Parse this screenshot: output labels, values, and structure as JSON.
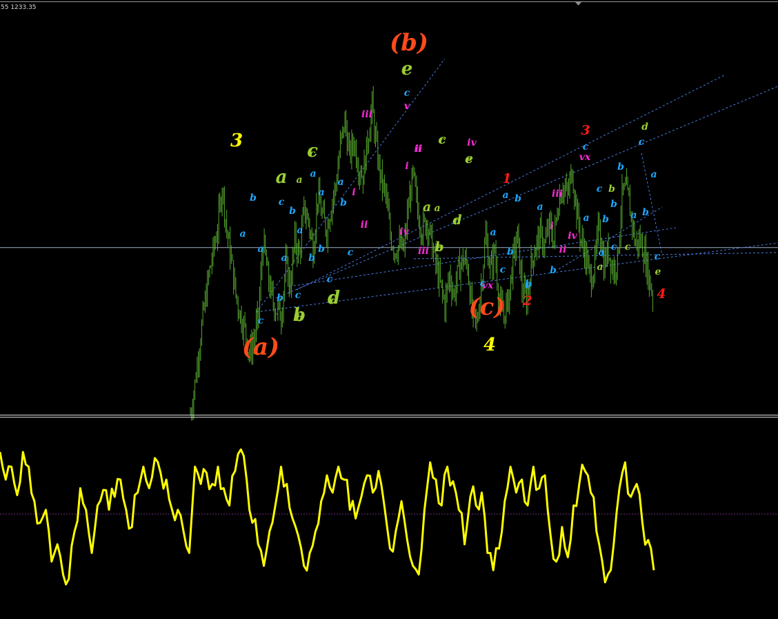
{
  "header": {
    "price_readout": "55 1233.35"
  },
  "colors": {
    "background": "#000000",
    "price_candles": "#55a82e",
    "oscillator": "#ffff00",
    "trendlines": "#4a7be0",
    "crosshair": "#9fb0c8",
    "zero_line": "#7a2a8a",
    "separator": "#ffffff"
  },
  "chart_data": [
    {
      "type": "bar",
      "description_key": "price",
      "title": "",
      "xlabel": "",
      "ylabel": "",
      "ylim": [
        0,
        100
      ],
      "grid": false,
      "crosshair_level": 67,
      "closes_pct_of_range": [
        0,
        12,
        28,
        42,
        55,
        65,
        75,
        92,
        74,
        62,
        48,
        40,
        34,
        24,
        30,
        40,
        70,
        56,
        46,
        42,
        40,
        60,
        52,
        70,
        64,
        82,
        78,
        66,
        88,
        80,
        74,
        84,
        92,
        108,
        118,
        104,
        110,
        100,
        96,
        110,
        124,
        106,
        94,
        88,
        72,
        66,
        68,
        66,
        84,
        96,
        82,
        74,
        78,
        70,
        60,
        52,
        44,
        56,
        48,
        58,
        62,
        60,
        40,
        36,
        52,
        72,
        58,
        66,
        44,
        40,
        46,
        62,
        72,
        50,
        46,
        60,
        68,
        72,
        68,
        76,
        70,
        86,
        92,
        88,
        98,
        82,
        70,
        64,
        54,
        60,
        78,
        60,
        66,
        58,
        62,
        88,
        90,
        80,
        68,
        70,
        64,
        54,
        46
      ],
      "wave_labels": [
        {
          "text": "3",
          "color": "#ffff00",
          "size": "large"
        },
        {
          "text": "(a)",
          "color": "#ff4a1a",
          "size": "xlarge"
        },
        {
          "text": "(b)",
          "color": "#ff4a1a",
          "size": "xlarge"
        },
        {
          "text": "(c)",
          "color": "#ff4a1a",
          "size": "xlarge"
        },
        {
          "text": "4",
          "color": "#ffff00",
          "size": "large"
        },
        {
          "text": "a",
          "color": "#9acd32",
          "size": "large"
        },
        {
          "text": "b",
          "color": "#9acd32",
          "size": "large"
        },
        {
          "text": "c",
          "color": "#9acd32",
          "size": "large"
        },
        {
          "text": "d",
          "color": "#9acd32",
          "size": "large"
        },
        {
          "text": "e",
          "color": "#9acd32",
          "size": "large"
        },
        {
          "text": "1",
          "color": "#ff1a1a",
          "size": "medium"
        },
        {
          "text": "2",
          "color": "#ff1a1a",
          "size": "medium"
        },
        {
          "text": "3",
          "color": "#ff1a1a",
          "size": "medium"
        },
        {
          "text": "4",
          "color": "#ff1a1a",
          "size": "medium"
        },
        {
          "text": "a",
          "color": "#9acd32",
          "size": "medium"
        },
        {
          "text": "b",
          "color": "#9acd32",
          "size": "medium"
        },
        {
          "text": "c",
          "color": "#9acd32",
          "size": "medium"
        },
        {
          "text": "d",
          "color": "#9acd32",
          "size": "medium"
        },
        {
          "text": "e",
          "color": "#9acd32",
          "size": "medium"
        },
        {
          "text": "a",
          "color": "#9acd32",
          "size": "small"
        },
        {
          "text": "b",
          "color": "#9acd32",
          "size": "small"
        },
        {
          "text": "c",
          "color": "#9acd32",
          "size": "small"
        },
        {
          "text": "d",
          "color": "#9acd32",
          "size": "small"
        },
        {
          "text": "e",
          "color": "#9acd32",
          "size": "small"
        },
        {
          "text": "a",
          "color": "#9acd32",
          "size": "small"
        },
        {
          "text": "b",
          "color": "#9acd32",
          "size": "small"
        },
        {
          "text": "c",
          "color": "#9acd32",
          "size": "small"
        },
        {
          "text": "d",
          "color": "#9acd32",
          "size": "small"
        },
        {
          "text": "a",
          "color": "#9acd32",
          "size": "small"
        },
        {
          "text": "b",
          "color": "#9acd32",
          "size": "small"
        },
        {
          "text": "c",
          "color": "#9acd32",
          "size": "small"
        },
        {
          "text": "d",
          "color": "#9acd32",
          "size": "small"
        },
        {
          "text": "e",
          "color": "#9acd32",
          "size": "small"
        },
        {
          "text": "iii",
          "color": "#ff2bd8",
          "size": "small"
        },
        {
          "text": "v",
          "color": "#ff2bd8",
          "size": "small"
        },
        {
          "text": "ii",
          "color": "#ff2bd8",
          "size": "small"
        },
        {
          "text": "i",
          "color": "#ff2bd8",
          "size": "small"
        },
        {
          "text": "iv",
          "color": "#ff2bd8",
          "size": "small"
        },
        {
          "text": "i",
          "color": "#ff2bd8",
          "size": "small"
        },
        {
          "text": "ii",
          "color": "#ff2bd8",
          "size": "small"
        },
        {
          "text": "iv",
          "color": "#ff2bd8",
          "size": "small"
        },
        {
          "text": "iii",
          "color": "#ff2bd8",
          "size": "small"
        },
        {
          "text": "vx",
          "color": "#ff2bd8",
          "size": "small"
        },
        {
          "text": "iii",
          "color": "#ff2bd8",
          "size": "small"
        },
        {
          "text": "i",
          "color": "#ff2bd8",
          "size": "small"
        },
        {
          "text": "iv",
          "color": "#ff2bd8",
          "size": "small"
        },
        {
          "text": "ii",
          "color": "#ff2bd8",
          "size": "small"
        },
        {
          "text": "vx",
          "color": "#ff2bd8",
          "size": "small"
        },
        {
          "text": "ii",
          "color": "#ff2bd8",
          "size": "small"
        },
        {
          "text": "a",
          "color": "#1ea8ff",
          "size": "small"
        },
        {
          "text": "b",
          "color": "#1ea8ff",
          "size": "small"
        },
        {
          "text": "a",
          "color": "#1ea8ff",
          "size": "small"
        },
        {
          "text": "c",
          "color": "#1ea8ff",
          "size": "small"
        },
        {
          "text": "b",
          "color": "#1ea8ff",
          "size": "small"
        },
        {
          "text": "c",
          "color": "#1ea8ff",
          "size": "small"
        },
        {
          "text": "b",
          "color": "#1ea8ff",
          "size": "small"
        },
        {
          "text": "a",
          "color": "#1ea8ff",
          "size": "small"
        },
        {
          "text": "a",
          "color": "#1ea8ff",
          "size": "small"
        },
        {
          "text": "b",
          "color": "#1ea8ff",
          "size": "small"
        },
        {
          "text": "c",
          "color": "#1ea8ff",
          "size": "small"
        },
        {
          "text": "a",
          "color": "#1ea8ff",
          "size": "small"
        },
        {
          "text": "b",
          "color": "#1ea8ff",
          "size": "small"
        },
        {
          "text": "a",
          "color": "#1ea8ff",
          "size": "small"
        },
        {
          "text": "b",
          "color": "#1ea8ff",
          "size": "small"
        },
        {
          "text": "c",
          "color": "#1ea8ff",
          "size": "small"
        },
        {
          "text": "c",
          "color": "#1ea8ff",
          "size": "small"
        },
        {
          "text": "c",
          "color": "#1ea8ff",
          "size": "small"
        },
        {
          "text": "b",
          "color": "#1ea8ff",
          "size": "small"
        },
        {
          "text": "a",
          "color": "#1ea8ff",
          "size": "small"
        },
        {
          "text": "a",
          "color": "#1ea8ff",
          "size": "small"
        },
        {
          "text": "b",
          "color": "#1ea8ff",
          "size": "small"
        },
        {
          "text": "c",
          "color": "#1ea8ff",
          "size": "small"
        },
        {
          "text": "b",
          "color": "#1ea8ff",
          "size": "small"
        },
        {
          "text": "a",
          "color": "#1ea8ff",
          "size": "small"
        },
        {
          "text": "b",
          "color": "#1ea8ff",
          "size": "small"
        },
        {
          "text": "c",
          "color": "#1ea8ff",
          "size": "small"
        },
        {
          "text": "a",
          "color": "#1ea8ff",
          "size": "small"
        },
        {
          "text": "c",
          "color": "#1ea8ff",
          "size": "small"
        },
        {
          "text": "a",
          "color": "#1ea8ff",
          "size": "small"
        },
        {
          "text": "b",
          "color": "#1ea8ff",
          "size": "small"
        },
        {
          "text": "c",
          "color": "#1ea8ff",
          "size": "small"
        },
        {
          "text": "b",
          "color": "#1ea8ff",
          "size": "small"
        },
        {
          "text": "a",
          "color": "#1ea8ff",
          "size": "small"
        },
        {
          "text": "c",
          "color": "#1ea8ff",
          "size": "small"
        },
        {
          "text": "b",
          "color": "#1ea8ff",
          "size": "small"
        },
        {
          "text": "a",
          "color": "#1ea8ff",
          "size": "small"
        },
        {
          "text": "c",
          "color": "#1ea8ff",
          "size": "small"
        },
        {
          "text": "b",
          "color": "#1ea8ff",
          "size": "small"
        },
        {
          "text": "a",
          "color": "#1ea8ff",
          "size": "small"
        },
        {
          "text": "c",
          "color": "#1ea8ff",
          "size": "small"
        },
        {
          "text": "c",
          "color": "#1ea8ff",
          "size": "small"
        }
      ]
    },
    {
      "type": "line",
      "description_key": "oscillator",
      "title": "",
      "xlabel": "",
      "ylabel": "",
      "ylim": [
        -1,
        1
      ],
      "zero_line": 0,
      "grid": false,
      "values": [
        0.72,
        0.4,
        0.55,
        0.22,
        0.72,
        0.55,
        0.15,
        -0.1,
        0.05,
        -0.55,
        -0.35,
        -0.7,
        -0.75,
        -0.2,
        0.3,
        0.05,
        -0.45,
        0.1,
        0.28,
        0.05,
        0.2,
        0.4,
        0.05,
        -0.15,
        0.25,
        0.55,
        0.3,
        0.65,
        0.48,
        0.4,
        0.05,
        0.05,
        -0.2,
        -0.45,
        0.55,
        0.35,
        0.48,
        0.35,
        0.55,
        0.3,
        0.1,
        0.5,
        0.75,
        0.4,
        -0.1,
        -0.35,
        -0.6,
        -0.2,
        0.1,
        0.55,
        0.35,
        -0.05,
        -0.25,
        -0.6,
        -0.45,
        -0.2,
        0.15,
        0.45,
        0.25,
        0.55,
        0.4,
        0.05,
        -0.05,
        0.2,
        0.45,
        0.25,
        0.5,
        0.1,
        -0.4,
        -0.2,
        0.15,
        -0.3,
        -0.6,
        -0.7,
        0.05,
        0.6,
        0.4,
        0.1,
        0.55,
        0.38,
        0.05,
        -0.35,
        0.2,
        0.1,
        0.25,
        -0.45,
        -0.65,
        -0.4,
        0.15,
        0.55,
        0.25,
        0.4,
        0.1,
        0.55,
        0.3,
        0.45,
        -0.25,
        -0.55,
        -0.15,
        -0.5,
        0.1,
        0.35,
        0.5,
        0.25,
        -0.2,
        -0.55,
        -0.7,
        -0.35,
        0.3,
        0.6,
        0.2,
        0.35,
        -0.1,
        -0.3,
        -0.65
      ]
    }
  ]
}
